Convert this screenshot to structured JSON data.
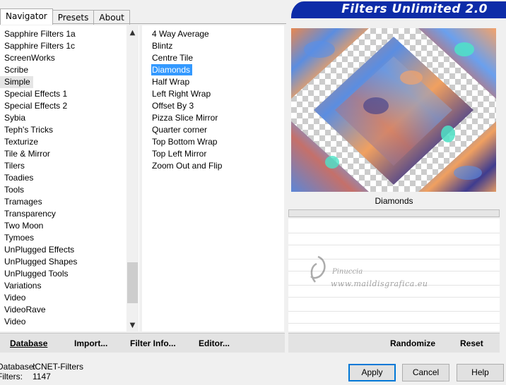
{
  "tabs": [
    {
      "label": "Navigator",
      "active": true
    },
    {
      "label": "Presets",
      "active": false
    },
    {
      "label": "About",
      "active": false
    }
  ],
  "banner": {
    "title": "Filters Unlimited 2.0",
    "color": "#0d2ca8"
  },
  "categories": [
    {
      "label": "Sapphire Filters 1a"
    },
    {
      "label": "Sapphire Filters 1c"
    },
    {
      "label": "ScreenWorks"
    },
    {
      "label": "Scribe"
    },
    {
      "label": "Simple",
      "selected": true
    },
    {
      "label": "Special Effects 1"
    },
    {
      "label": "Special Effects 2"
    },
    {
      "label": "Sybia"
    },
    {
      "label": "Teph's Tricks"
    },
    {
      "label": "Texturize"
    },
    {
      "label": "Tile & Mirror"
    },
    {
      "label": "Tilers"
    },
    {
      "label": "Toadies"
    },
    {
      "label": "Tools"
    },
    {
      "label": "Tramages"
    },
    {
      "label": "Transparency"
    },
    {
      "label": "Two Moon"
    },
    {
      "label": "Tymoes"
    },
    {
      "label": "UnPlugged Effects"
    },
    {
      "label": "UnPlugged Shapes"
    },
    {
      "label": "UnPlugged Tools"
    },
    {
      "label": "Variations"
    },
    {
      "label": "Video"
    },
    {
      "label": "VideoRave"
    },
    {
      "label": "Video"
    }
  ],
  "filters": [
    {
      "label": "4 Way Average"
    },
    {
      "label": "Blintz"
    },
    {
      "label": "Centre Tile"
    },
    {
      "label": "Diamonds",
      "selected": true
    },
    {
      "label": "Half Wrap"
    },
    {
      "label": "Left Right Wrap"
    },
    {
      "label": "Offset By 3"
    },
    {
      "label": "Pizza Slice Mirror"
    },
    {
      "label": "Quarter corner"
    },
    {
      "label": "Top Bottom Wrap"
    },
    {
      "label": "Top Left Mirror"
    },
    {
      "label": "Zoom Out and Flip"
    }
  ],
  "toolbar": {
    "database": "Database",
    "import": "Import...",
    "filter_info": "Filter Info...",
    "editor": "Editor...",
    "randomize": "Randomize",
    "reset": "Reset"
  },
  "preview": {
    "filter_name": "Diamonds"
  },
  "watermark": {
    "name": "Pinuccia",
    "url": "www.maildisgrafica.eu"
  },
  "status": {
    "database_label": "Database:",
    "database_value": "ICNET-Filters",
    "filters_label": "Filters:",
    "filters_value": "1147"
  },
  "dialog": {
    "apply": "Apply",
    "cancel": "Cancel",
    "help": "Help"
  },
  "colors": {
    "selection": "#3399ff",
    "banner": "#0d2ca8"
  }
}
